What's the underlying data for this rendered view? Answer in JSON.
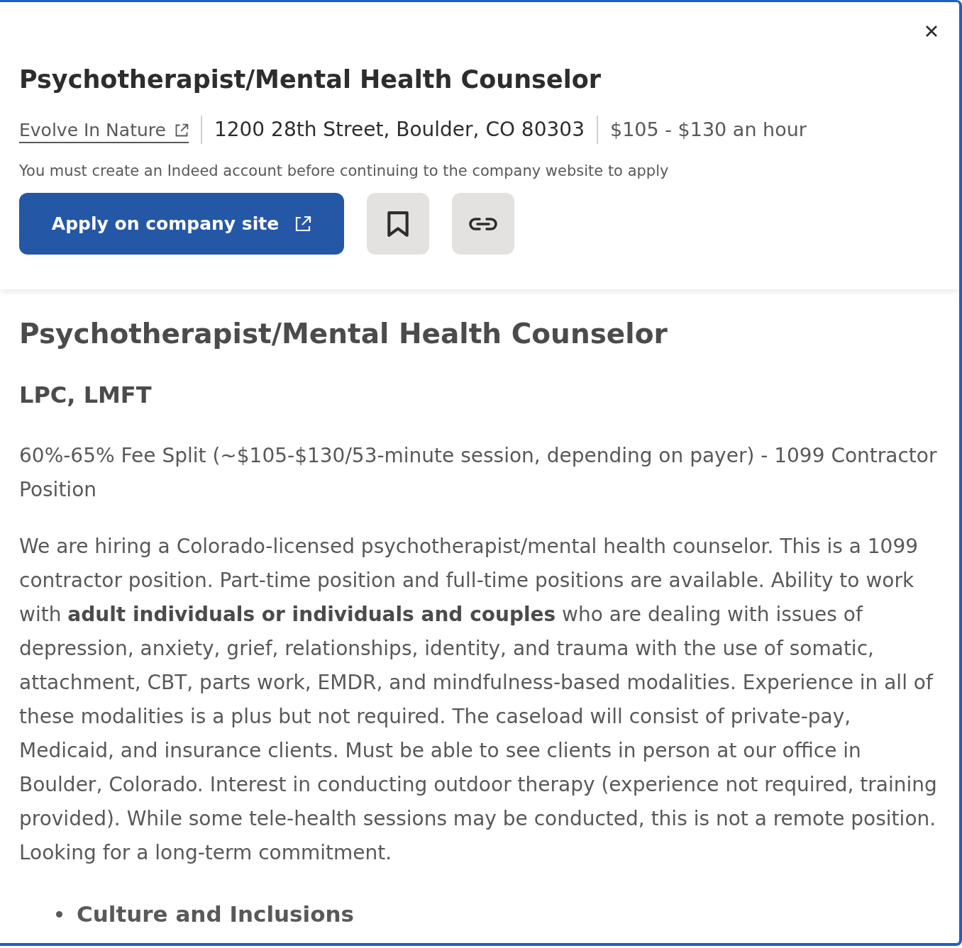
{
  "header": {
    "title": "Psychotherapist/Mental Health Counselor",
    "company": "Evolve In Nature",
    "location": "1200 28th Street, Boulder, CO 80303",
    "salary": "$105 - $130 an hour",
    "notice": "You must create an Indeed account before continuing to the company website to apply",
    "apply_button": "Apply on company site"
  },
  "description": {
    "title": "Psychotherapist/Mental Health Counselor",
    "subtitle": "LPC, LMFT",
    "paragraphs": [
      "60%-65% Fee Split (~$105-$130/53-minute session, depending on payer) - 1099 Contractor Position",
      "We are hiring a Colorado-licensed psychotherapist/mental health counselor. This is a 1099 contractor position. Part-time position and full-time positions are available. Ability to work with **adult individuals or individuals and couples** who are dealing with issues of depression, anxiety, grief, relationships, identity, and trauma with the use of somatic, attachment, CBT, parts work, EMDR, and mindfulness-based modalities. Experience in all of these modalities is a plus but not required. The caseload will consist of private-pay, Medicaid, and insurance clients. Must be able to see clients in person at our office in Boulder, Colorado. Interest in conducting outdoor therapy (experience not required, training provided). While some tele-health sessions may be conducted, this is not a remote position. Looking for a long-term commitment."
    ],
    "bullets": [
      "Culture and Inclusions"
    ]
  }
}
